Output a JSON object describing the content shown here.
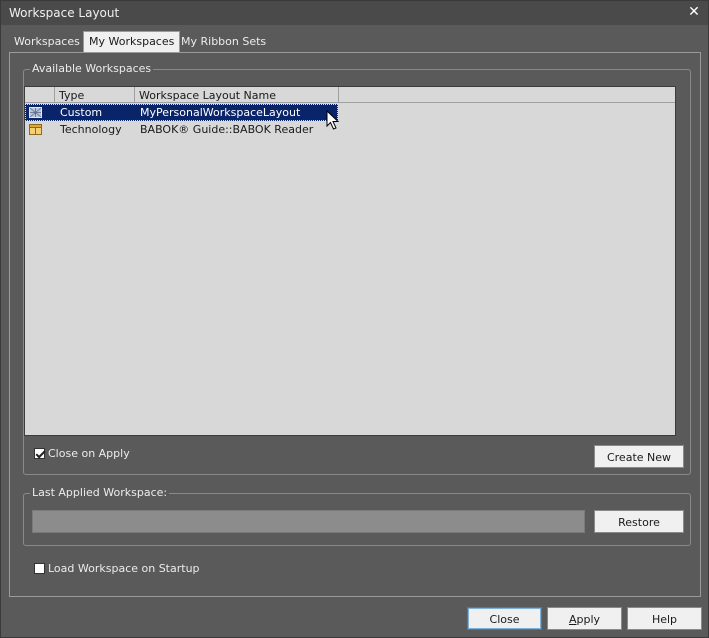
{
  "window": {
    "title": "Workspace Layout",
    "close_glyph": "✕"
  },
  "tabs": [
    {
      "label": "Workspaces",
      "active": false
    },
    {
      "label": "My Workspaces",
      "active": true
    },
    {
      "label": "My Ribbon Sets",
      "active": false
    }
  ],
  "available": {
    "legend": "Available Workspaces",
    "columns": [
      "Type",
      "Workspace Layout Name"
    ],
    "rows": [
      {
        "icon": "custom-workspace-icon",
        "type": "Custom",
        "name": "MyPersonalWorkspaceLayout",
        "selected": true
      },
      {
        "icon": "technology-workspace-icon",
        "type": "Technology",
        "name": "BABOK® Guide::BABOK Reader",
        "selected": false
      }
    ],
    "close_on_apply_label": "Close on Apply",
    "close_on_apply_checked": true,
    "create_new_label": "Create New"
  },
  "last_applied": {
    "legend": "Last Applied Workspace:",
    "value": "",
    "restore_label": "Restore"
  },
  "startup": {
    "label": "Load Workspace on Startup",
    "checked": false
  },
  "footer": {
    "close_label": "Close",
    "apply_label_pre": "",
    "apply_label_mnemonic": "A",
    "apply_label_post": "pply",
    "help_label": "Help"
  }
}
